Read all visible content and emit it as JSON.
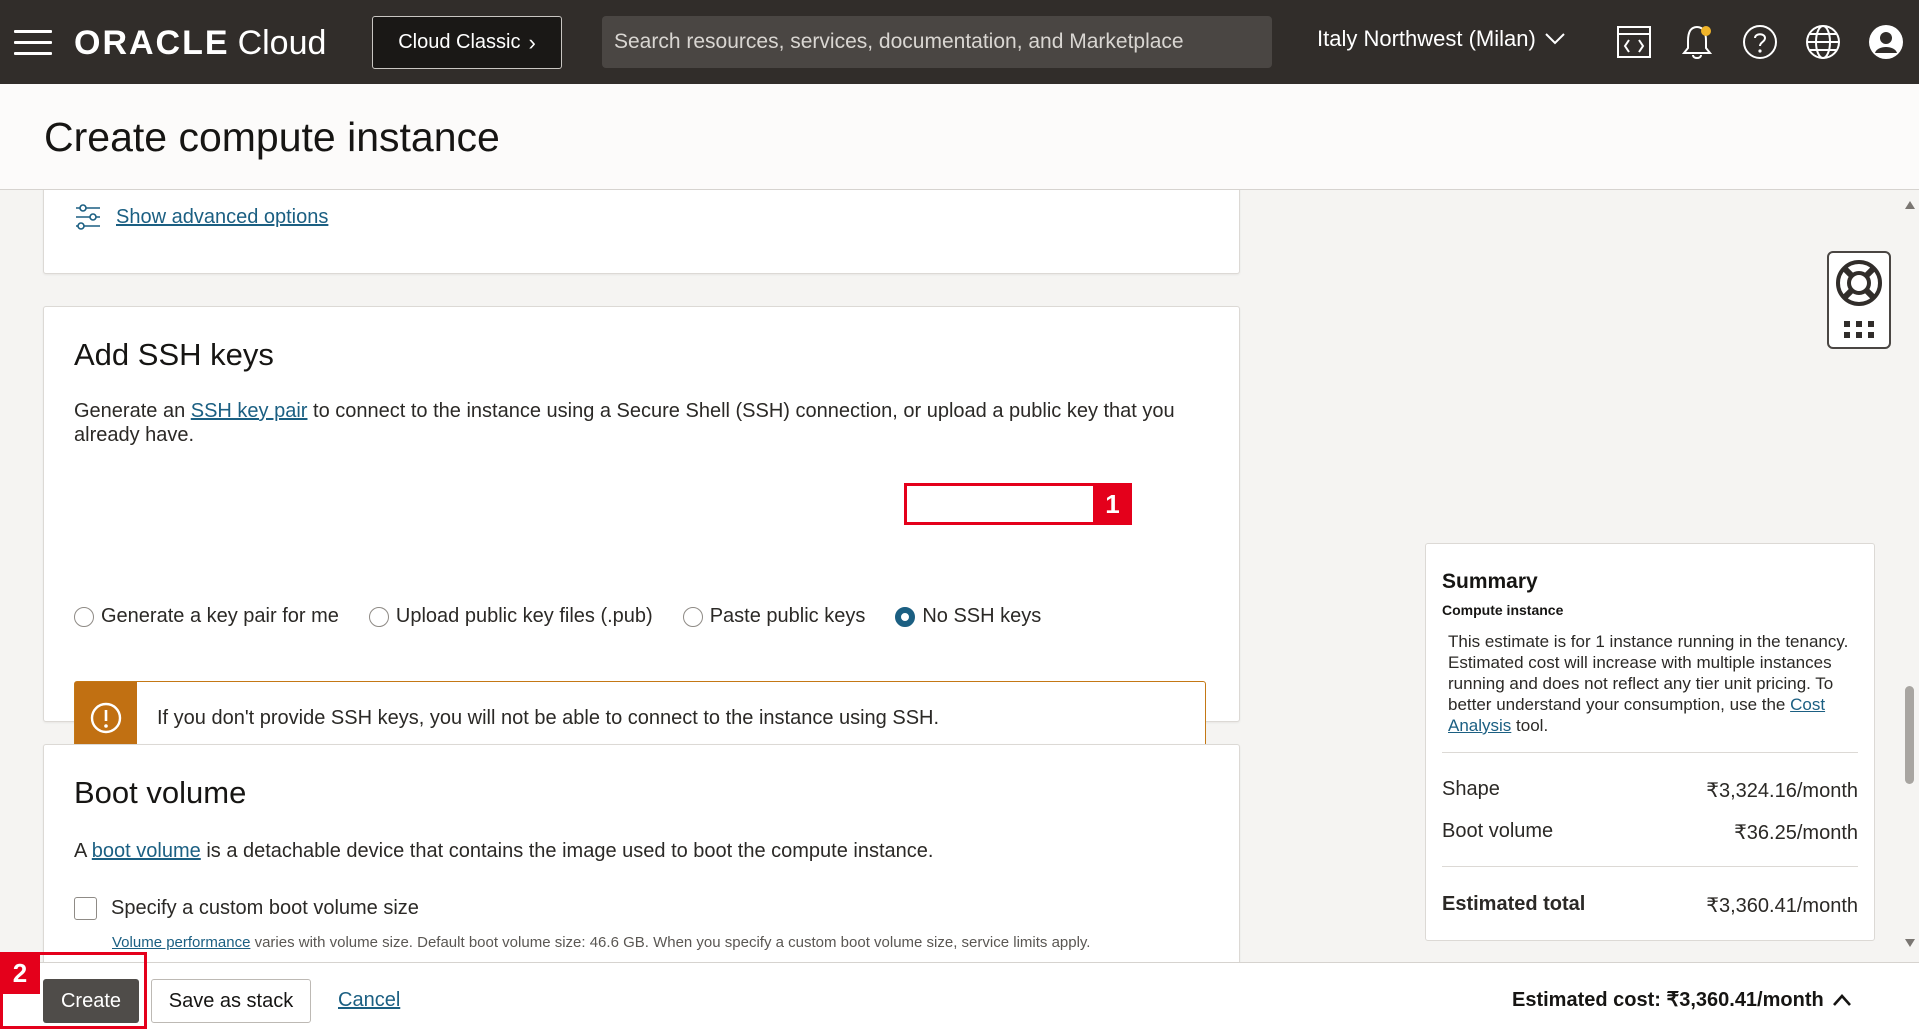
{
  "topbar": {
    "brand": "ORACLE",
    "product": "Cloud",
    "classic_button": "Cloud Classic",
    "search_placeholder": "Search resources, services, documentation, and Marketplace",
    "region": "Italy Northwest (Milan)"
  },
  "page": {
    "title": "Create compute instance"
  },
  "advanced": {
    "link": "Show advanced options"
  },
  "ssh": {
    "title": "Add SSH keys",
    "desc_prefix": "Generate an ",
    "desc_link": "SSH key pair",
    "desc_suffix": " to connect to the instance using a Secure Shell (SSH) connection, or upload a public key that you already have.",
    "options": [
      {
        "label": "Generate a key pair for me",
        "checked": false
      },
      {
        "label": "Upload public key files (.pub)",
        "checked": false
      },
      {
        "label": "Paste public keys",
        "checked": false
      },
      {
        "label": "No SSH keys",
        "checked": true
      }
    ],
    "warning": "If you don't provide SSH keys, you will not be able to connect to the instance using SSH."
  },
  "boot": {
    "title": "Boot volume",
    "desc_prefix": "A ",
    "desc_link": "boot volume",
    "desc_suffix": " is a detachable device that contains the image used to boot the compute instance.",
    "checkbox_label": "Specify a custom boot volume size",
    "perf_link": "Volume performance",
    "perf_text": " varies with volume size. Default boot volume size: 46.6 GB. When you specify a custom boot volume size, service limits apply."
  },
  "summary": {
    "title": "Summary",
    "subtitle": "Compute instance",
    "note_prefix": "This estimate is for 1 instance running in the tenancy. Estimated cost will increase with multiple instances running and does not reflect any tier unit pricing. To better understand your consumption, use the ",
    "note_link": "Cost Analysis",
    "note_suffix": " tool.",
    "rows": [
      {
        "label": "Shape",
        "value": "₹3,324.16/month"
      },
      {
        "label": "Boot volume",
        "value": "₹36.25/month"
      }
    ],
    "total_label": "Estimated total",
    "total_value": "₹3,360.41/month"
  },
  "footer": {
    "create": "Create",
    "save_stack": "Save as stack",
    "cancel": "Cancel",
    "estimated_cost": "Estimated cost: ₹3,360.41/month"
  },
  "annotations": {
    "step1": "1",
    "step2": "2"
  },
  "colors": {
    "topbar": "#312d2a",
    "link": "#1b5f82",
    "warning": "#c17012",
    "annotation": "#e4001b"
  }
}
